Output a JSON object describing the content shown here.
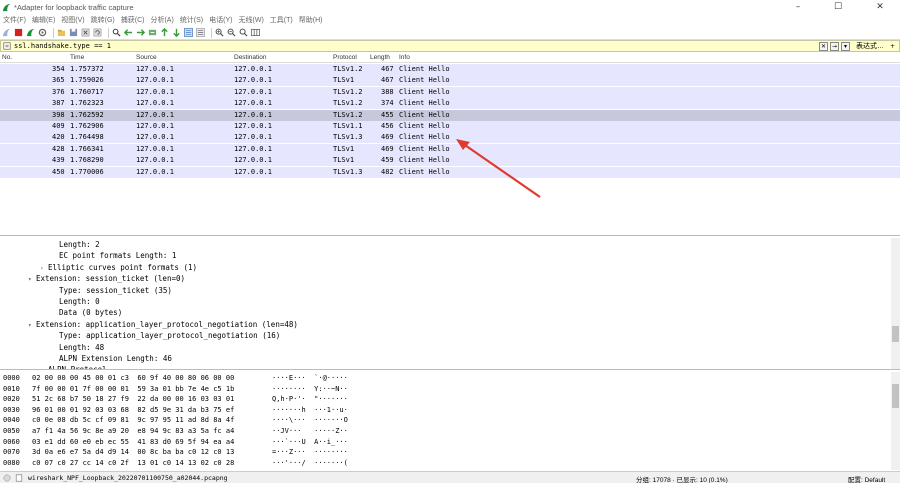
{
  "window": {
    "title": "*Adapter for loopback traffic capture",
    "controls": [
      "–",
      "☐",
      "✕"
    ]
  },
  "menu": [
    "文件(F)",
    "编辑(E)",
    "视图(V)",
    "跳转(G)",
    "捕获(C)",
    "分析(A)",
    "统计(S)",
    "电话(Y)",
    "无线(W)",
    "工具(T)",
    "帮助(H)"
  ],
  "filter": {
    "value": "ssl.handshake.type == 1",
    "expression_label": "表达式…",
    "clear_glyph": "✕",
    "apply_glyph": "→",
    "dropdown_glyph": "▾",
    "add_glyph": "+"
  },
  "packet_list": {
    "columns": [
      "No.",
      "Time",
      "Source",
      "Destination",
      "Protocol",
      "Length",
      "Info"
    ],
    "rows": [
      {
        "no": "354",
        "time": "1.757372",
        "src": "127.0.0.1",
        "dst": "127.0.0.1",
        "proto": "TLSv1.2",
        "len": "467",
        "info": "Client Hello"
      },
      {
        "no": "365",
        "time": "1.759026",
        "src": "127.0.0.1",
        "dst": "127.0.0.1",
        "proto": "TLSv1",
        "len": "467",
        "info": "Client Hello"
      },
      {
        "no": "376",
        "time": "1.760717",
        "src": "127.0.0.1",
        "dst": "127.0.0.1",
        "proto": "TLSv1.2",
        "len": "388",
        "info": "Client Hello"
      },
      {
        "no": "387",
        "time": "1.762323",
        "src": "127.0.0.1",
        "dst": "127.0.0.1",
        "proto": "TLSv1.2",
        "len": "374",
        "info": "Client Hello"
      },
      {
        "no": "398",
        "time": "1.762592",
        "src": "127.0.0.1",
        "dst": "127.0.0.1",
        "proto": "TLSv1.2",
        "len": "455",
        "info": "Client Hello",
        "selected": true
      },
      {
        "no": "409",
        "time": "1.762906",
        "src": "127.0.0.1",
        "dst": "127.0.0.1",
        "proto": "TLSv1.1",
        "len": "456",
        "info": "Client Hello"
      },
      {
        "no": "420",
        "time": "1.764498",
        "src": "127.0.0.1",
        "dst": "127.0.0.1",
        "proto": "TLSv1.3",
        "len": "469",
        "info": "Client Hello"
      },
      {
        "no": "428",
        "time": "1.766341",
        "src": "127.0.0.1",
        "dst": "127.0.0.1",
        "proto": "TLSv1",
        "len": "469",
        "info": "Client Hello"
      },
      {
        "no": "439",
        "time": "1.768290",
        "src": "127.0.0.1",
        "dst": "127.0.0.1",
        "proto": "TLSv1",
        "len": "459",
        "info": "Client Hello"
      },
      {
        "no": "450",
        "time": "1.770006",
        "src": "127.0.0.1",
        "dst": "127.0.0.1",
        "proto": "TLSv1.3",
        "len": "482",
        "info": "Client Hello"
      }
    ]
  },
  "details": [
    {
      "level": 3,
      "arrow": "",
      "text": "Length: 2"
    },
    {
      "level": 3,
      "arrow": "",
      "text": "EC point formats Length: 1"
    },
    {
      "level": 2,
      "arrow": ">",
      "text": "Elliptic curves point formats (1)"
    },
    {
      "level": 1,
      "arrow": "v",
      "text": "Extension: session_ticket (len=0)"
    },
    {
      "level": 2,
      "arrow": "",
      "text": "Type: session_ticket (35)"
    },
    {
      "level": 2,
      "arrow": "",
      "text": "Length: 0"
    },
    {
      "level": 2,
      "arrow": "",
      "text": "Data (0 bytes)"
    },
    {
      "level": 1,
      "arrow": "v",
      "text": "Extension: application_layer_protocol_negotiation (len=48)"
    },
    {
      "level": 2,
      "arrow": "",
      "text": "Type: application_layer_protocol_negotiation (16)"
    },
    {
      "level": 2,
      "arrow": "",
      "text": "Length: 48"
    },
    {
      "level": 2,
      "arrow": "",
      "text": "ALPN Extension Length: 46"
    },
    {
      "level": 2,
      "arrow": "v",
      "text": "ALPN Protocol"
    }
  ],
  "hex": [
    {
      "off": "0000",
      "bytes": "02 00 00 00 45 00 01 c3  60 9f 40 00 80 06 00 00",
      "ascii": "····E···  `·@·····"
    },
    {
      "off": "0010",
      "bytes": "7f 00 00 01 7f 00 00 01  59 3a 01 bb 7e 4e c5 1b",
      "ascii": "········  Y:··~N··"
    },
    {
      "off": "0020",
      "bytes": "51 2c 68 b7 50 18 27 f9  22 da 00 00 16 03 03 01",
      "ascii": "Q,h·P·'·  \"·······"
    },
    {
      "off": "0030",
      "bytes": "96 01 00 01 92 03 03 68  82 d5 9e 31 da b3 75 ef",
      "ascii": "·······h  ···1··u·"
    },
    {
      "off": "0040",
      "bytes": "c0 0e 08 db 5c cf 09 81  9c 97 95 11 ad 8d 8a 4f",
      "ascii": "····\\···  ·······O"
    },
    {
      "off": "0050",
      "bytes": "a7 f1 4a 56 9c 8e a9 20  e8 94 9c 83 a3 5a fc a4",
      "ascii": "··JV···   ·····Z··"
    },
    {
      "off": "0060",
      "bytes": "03 e1 dd 60 e0 eb ec 55  41 83 d0 69 5f 94 ea a4",
      "ascii": "···`···U  A··i_···"
    },
    {
      "off": "0070",
      "bytes": "3d 0a e6 e7 5a d4 d9 14  00 8c ba ba c0 12 c0 13",
      "ascii": "=···Z···  ········"
    },
    {
      "off": "0080",
      "bytes": "c0 07 c0 27 cc 14 c0 2f  13 01 c0 14 13 02 c0 28",
      "ascii": "···'···/  ·······("
    }
  ],
  "status": {
    "file": "wireshark_NPF_Loopback_20220701100750_a02044.pcapng",
    "stats": "分组: 17078 · 已显示: 10 (0.1%)",
    "profile": "配置: Default"
  },
  "colors": {
    "row_tls": "#e7e6ff",
    "row_selected": "#c8c8dc",
    "filter_ok": "#ffffcc",
    "annotation_arrow": "#e03a2e"
  }
}
